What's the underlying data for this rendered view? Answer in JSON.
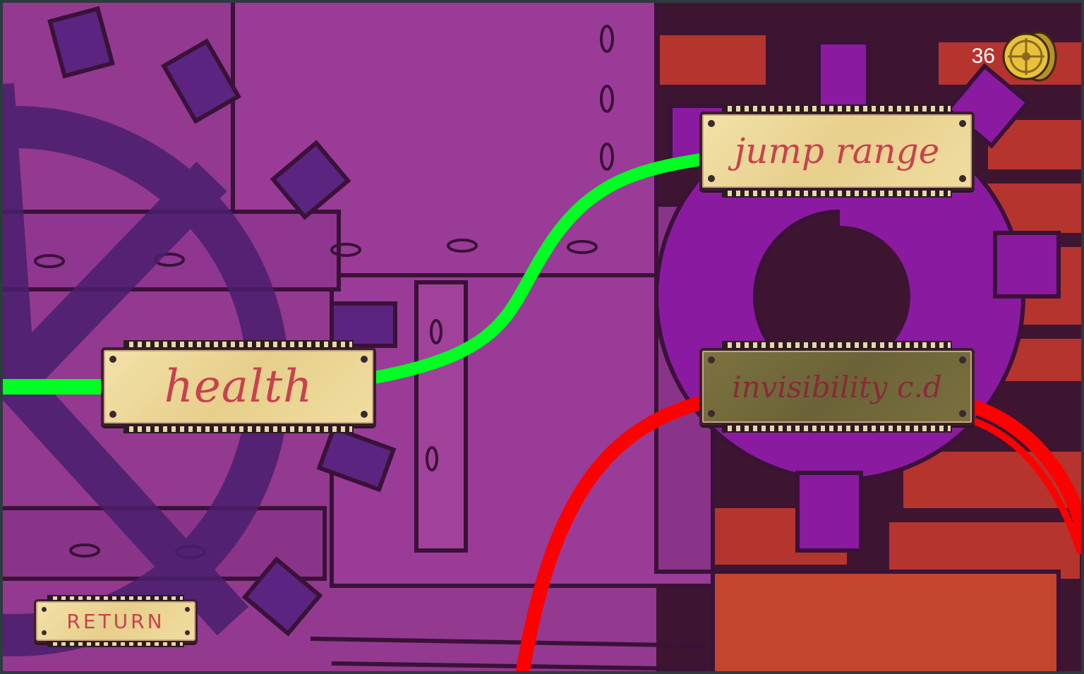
{
  "hud": {
    "coin_count": "36",
    "coin_icon": "gold-coin-icon"
  },
  "skill_tree": {
    "nodes": [
      {
        "id": "health",
        "label": "health",
        "state": "unlocked"
      },
      {
        "id": "jump",
        "label": "jump range",
        "state": "unlocked"
      },
      {
        "id": "invis",
        "label": "invisibility c.d",
        "state": "locked"
      }
    ],
    "connection_colors": {
      "unlocked": "#00ff22",
      "locked": "#ff0000"
    }
  },
  "return_button": {
    "label": "RETURN"
  },
  "colors": {
    "background_purple": "#93398f",
    "background_red": "#b6342e",
    "outline": "#3a1238"
  }
}
